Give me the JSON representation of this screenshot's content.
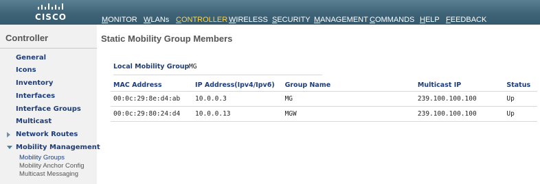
{
  "brand": {
    "logo_text": "CISCO"
  },
  "nav": [
    {
      "label": "MONITOR",
      "underline": "M",
      "rest": "ONITOR"
    },
    {
      "label": "WLANs",
      "underline": "W",
      "rest": "LANs"
    },
    {
      "label": "CONTROLLER",
      "underline": "C",
      "rest": "ONTROLLER",
      "active": true
    },
    {
      "label": "WIRELESS",
      "underline": "W",
      "rest": "IRELESS"
    },
    {
      "label": "SECURITY",
      "underline": "S",
      "rest": "ECURITY"
    },
    {
      "label": "MANAGEMENT",
      "underline": "M",
      "rest": "ANAGEMENT"
    },
    {
      "label": "COMMANDS",
      "underline": "C",
      "rest": "OMMANDS"
    },
    {
      "label": "HELP",
      "underline": "H",
      "rest": "ELP"
    },
    {
      "label": "FEEDBACK",
      "underline": "F",
      "rest": "EEDBACK"
    }
  ],
  "sidebar": {
    "title": "Controller",
    "items": [
      {
        "label": "General"
      },
      {
        "label": "Icons"
      },
      {
        "label": "Inventory"
      },
      {
        "label": "Interfaces"
      },
      {
        "label": "Interface Groups"
      },
      {
        "label": "Multicast"
      },
      {
        "label": "Network Routes",
        "arrow": "collapsed"
      },
      {
        "label": "Mobility Management",
        "arrow": "expanded"
      }
    ],
    "subitems": [
      {
        "label": "Mobility Groups",
        "active": true
      },
      {
        "label": "Mobility Anchor Config"
      },
      {
        "label": "Multicast Messaging"
      }
    ]
  },
  "main": {
    "title": "Static Mobility Group Members",
    "local_group_label": "Local Mobility Group",
    "local_group_value": "MG",
    "table": {
      "headers": [
        "MAC Address",
        "IP Address(Ipv4/Ipv6)",
        "Group Name",
        "Multicast IP",
        "Status"
      ],
      "rows": [
        [
          "00:0c:29:8e:d4:ab",
          "10.0.0.3",
          "MG",
          "239.100.100.100",
          "Up"
        ],
        [
          "00:0c:29:80:24:d4",
          "10.0.0.13",
          "MGW",
          "239.100.100.100",
          "Up"
        ]
      ]
    }
  },
  "colors": {
    "topbar": "#3f6377",
    "active_nav": "#ffd54a",
    "link": "#1d3c78",
    "sidebar_bg": "#f1f1f1"
  }
}
